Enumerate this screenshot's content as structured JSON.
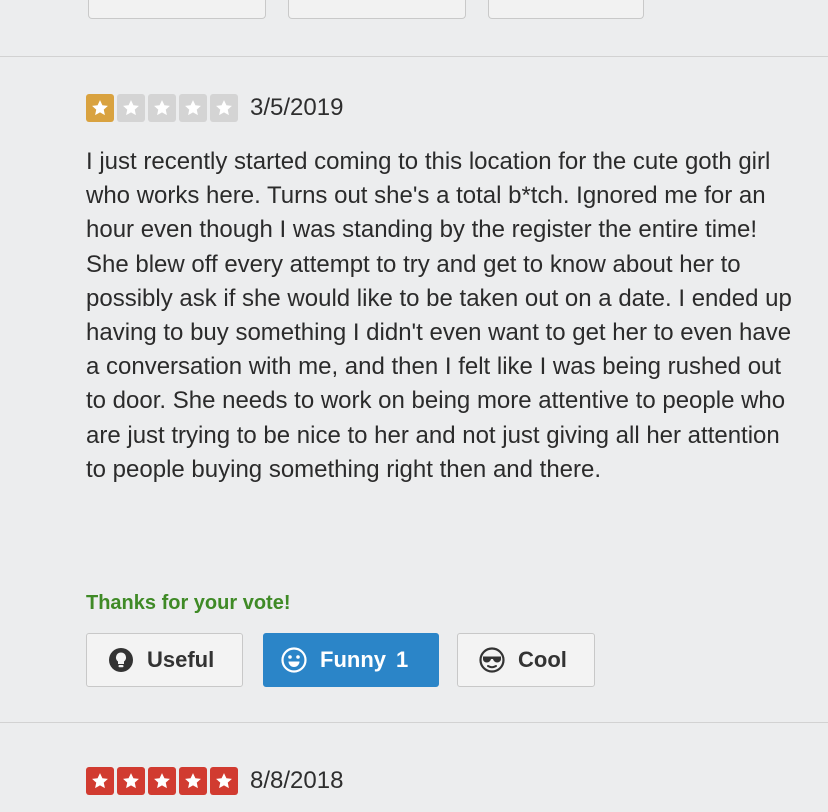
{
  "reviews": [
    {
      "rating": 1,
      "date": "3/5/2019",
      "text": "I just recently started coming to this location for the cute goth girl who works here. Turns out she's a total b*tch. Ignored me for an hour even though I was standing by the register the entire time! She blew off every attempt to try and get to know about her to possibly ask if she would like to be taken out on a date. I ended up having to buy something I didn't even want to get her to even have a conversation with me, and then I felt like I was being rushed out to door. She needs to work on being more attentive to people who are just trying to be nice to her and not just giving all her attention to people buying something right then and there.",
      "thanks_message": "Thanks for your vote!",
      "votes": {
        "useful_label": "Useful",
        "funny_label": "Funny",
        "funny_count": "1",
        "cool_label": "Cool"
      }
    },
    {
      "rating": 5,
      "date": "8/8/2018"
    }
  ],
  "colors": {
    "star_empty": "#d4d4d4",
    "star_one": "#d9a23f",
    "star_five": "#d13b30",
    "vote_active": "#2b85c8",
    "thanks_green": "#3f8a26"
  },
  "icons": {
    "star": "star-icon",
    "useful": "lightbulb-icon",
    "funny": "smiley-icon",
    "cool": "sunglasses-icon"
  }
}
